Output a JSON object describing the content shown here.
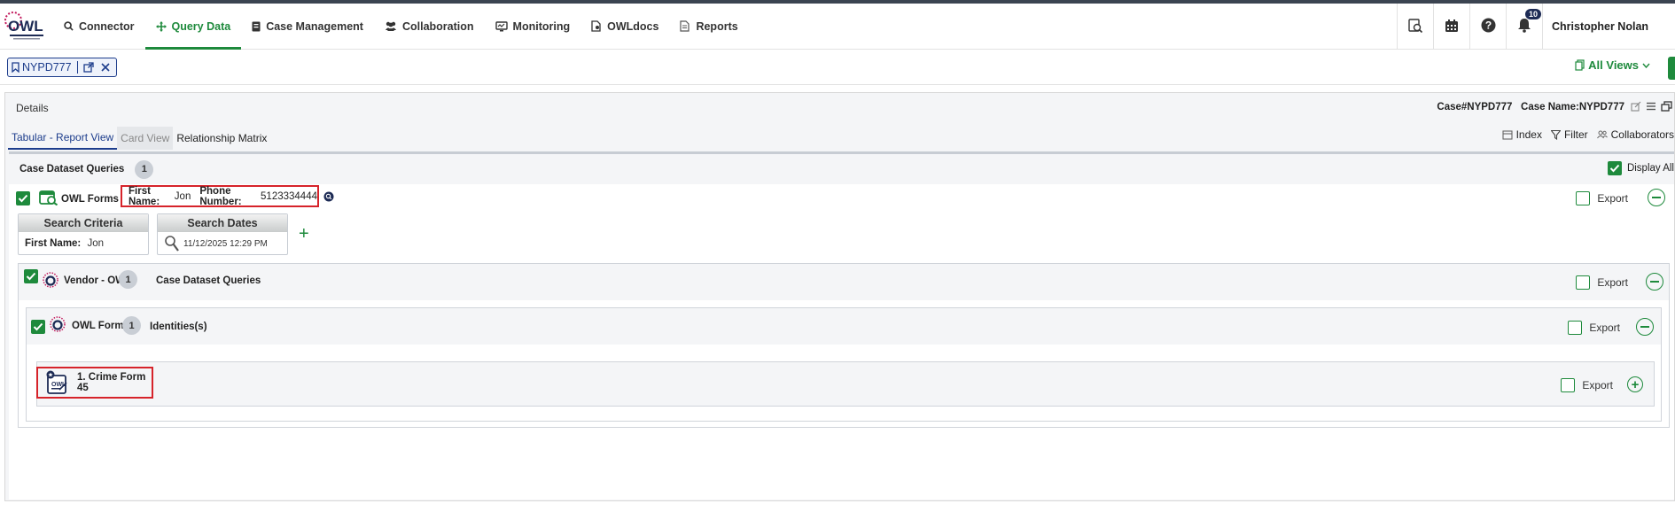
{
  "nav": {
    "items": [
      {
        "label": "Connector",
        "icon": "search-icon"
      },
      {
        "label": "Query Data",
        "icon": "move-arrows-icon",
        "active": true
      },
      {
        "label": "Case Management",
        "icon": "case-file-icon"
      },
      {
        "label": "Collaboration",
        "icon": "users-icon"
      },
      {
        "label": "Monitoring",
        "icon": "monitor-icon"
      },
      {
        "label": "OWLdocs",
        "icon": "docs-gear-icon"
      },
      {
        "label": "Reports",
        "icon": "reports-icon"
      }
    ],
    "notification_count": "10",
    "user_name": "Christopher Nolan"
  },
  "case_tab": {
    "label": "NYPD777"
  },
  "views": {
    "label": "All Views"
  },
  "details": {
    "title": "Details",
    "case_no_label": "Case#",
    "case_no": "NYPD777",
    "case_name_label": "Case Name:",
    "case_name": "NYPD777"
  },
  "view_tabs": [
    "Tabular - Report View",
    "Card View",
    "Relationship Matrix"
  ],
  "tools": {
    "index": "Index",
    "filter": "Filter",
    "collaborators": "Collaborators"
  },
  "dataset": {
    "title": "Case Dataset Queries",
    "count": "1",
    "display_all": "Display All"
  },
  "owl_forms": {
    "label": "OWL Forms",
    "first_name_label": "First Name:",
    "first_name": "Jon",
    "phone_label": "Phone Number:",
    "phone": "5123334444",
    "export": "Export"
  },
  "search_criteria": {
    "title": "Search Criteria",
    "label": "First Name:",
    "value": "Jon"
  },
  "search_dates": {
    "title": "Search Dates",
    "value": "11/12/2025 12:29 PM"
  },
  "vendor": {
    "label": "Vendor - OWL",
    "count": "1",
    "sub": "Case Dataset Queries",
    "export": "Export"
  },
  "owl_forms_group": {
    "label": "OWL Forms",
    "count": "1",
    "sub": "Identities(s)",
    "export": "Export"
  },
  "crime_form": {
    "label": "1. Crime Form 45",
    "export": "Export"
  },
  "colors": {
    "accent": "#1e8a3c",
    "navy": "#1d3d8c",
    "highlight": "#d6232a"
  }
}
